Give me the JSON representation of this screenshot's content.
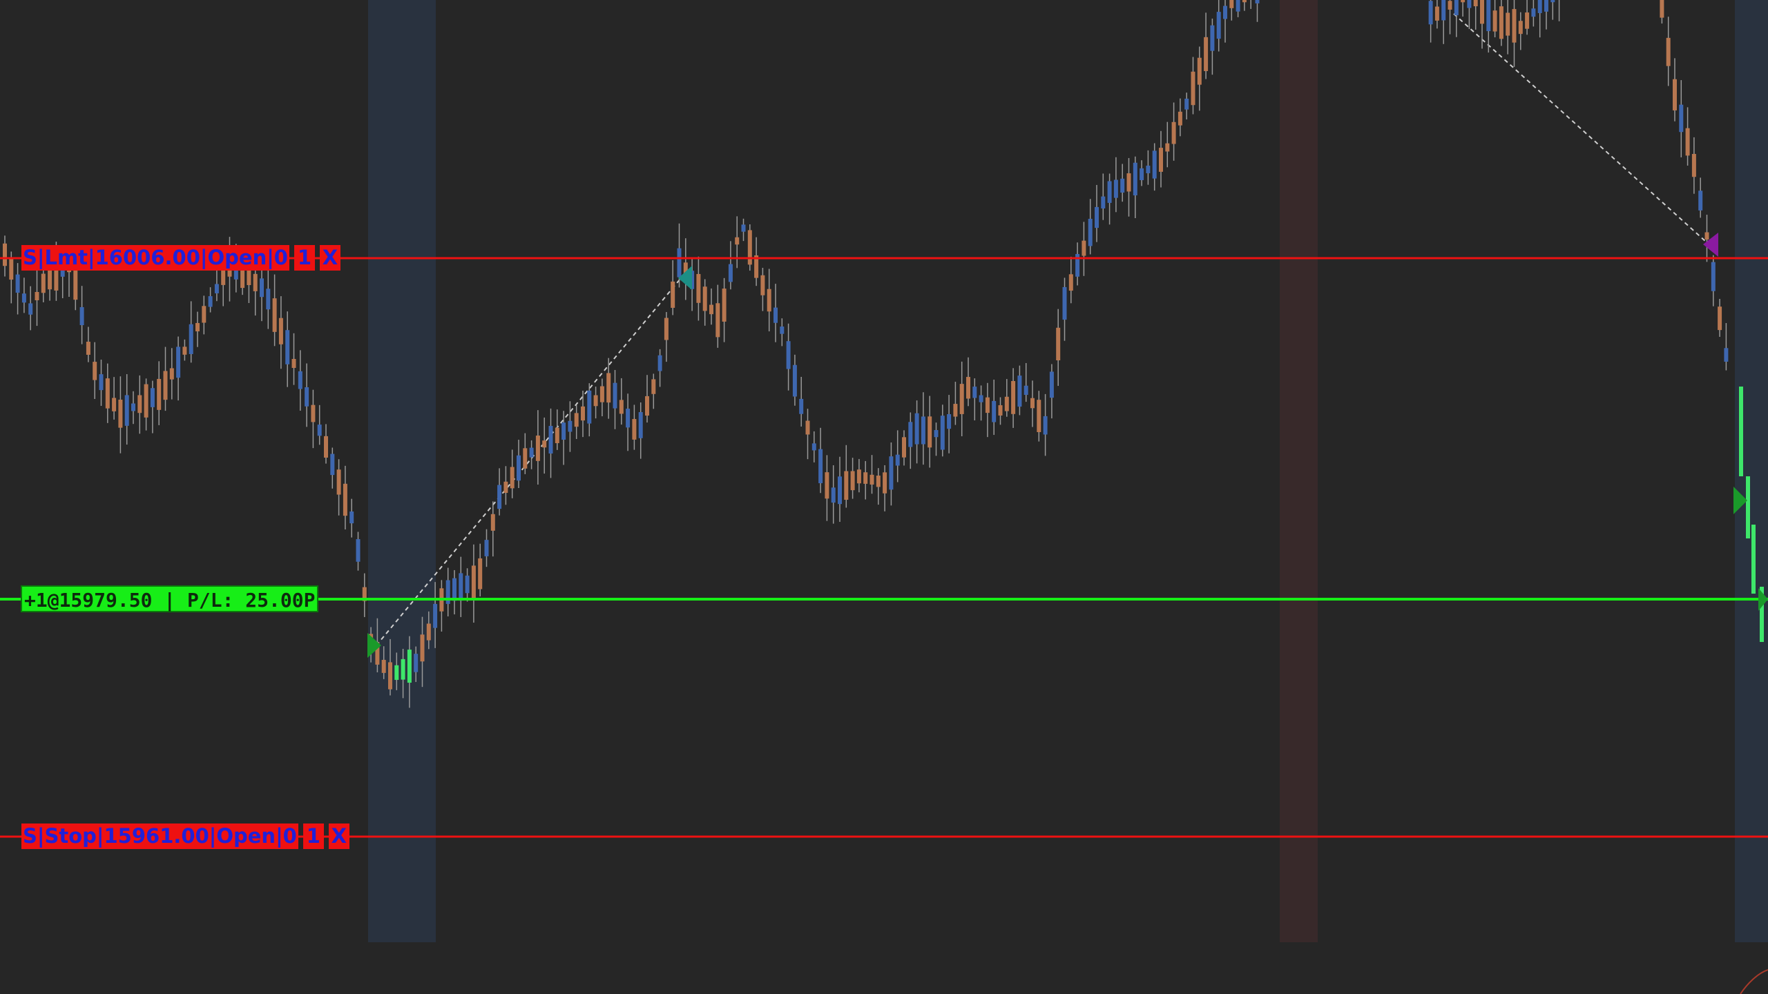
{
  "colors": {
    "background": "#262626",
    "up_candle": "#3e67b0",
    "down_candle": "#b87750",
    "highlight_up": "#3ee66a",
    "order_line": "#ee1111",
    "order_text": "#2020d8",
    "position_line": "#17ee17",
    "blue_session_band": "#2a3446",
    "brown_session_band": "#3a2b26"
  },
  "orders": {
    "limit": {
      "text": "S|Lmt|16006.00|Open|0",
      "qty": "1",
      "cancel": "X",
      "price": 16006.0
    },
    "stop": {
      "text": "S|Stop|15961.00|Open|0",
      "qty": "1",
      "cancel": "X",
      "price": 15961.0
    }
  },
  "position": {
    "text": "+1@15979.50 | P/L: 25.00P",
    "price": 15979.5
  },
  "icons": {
    "entry_marker": "green-triangle-right-icon",
    "exit_marker": "teal-triangle-left-icon",
    "short_marker": "purple-triangle-left-icon"
  }
}
